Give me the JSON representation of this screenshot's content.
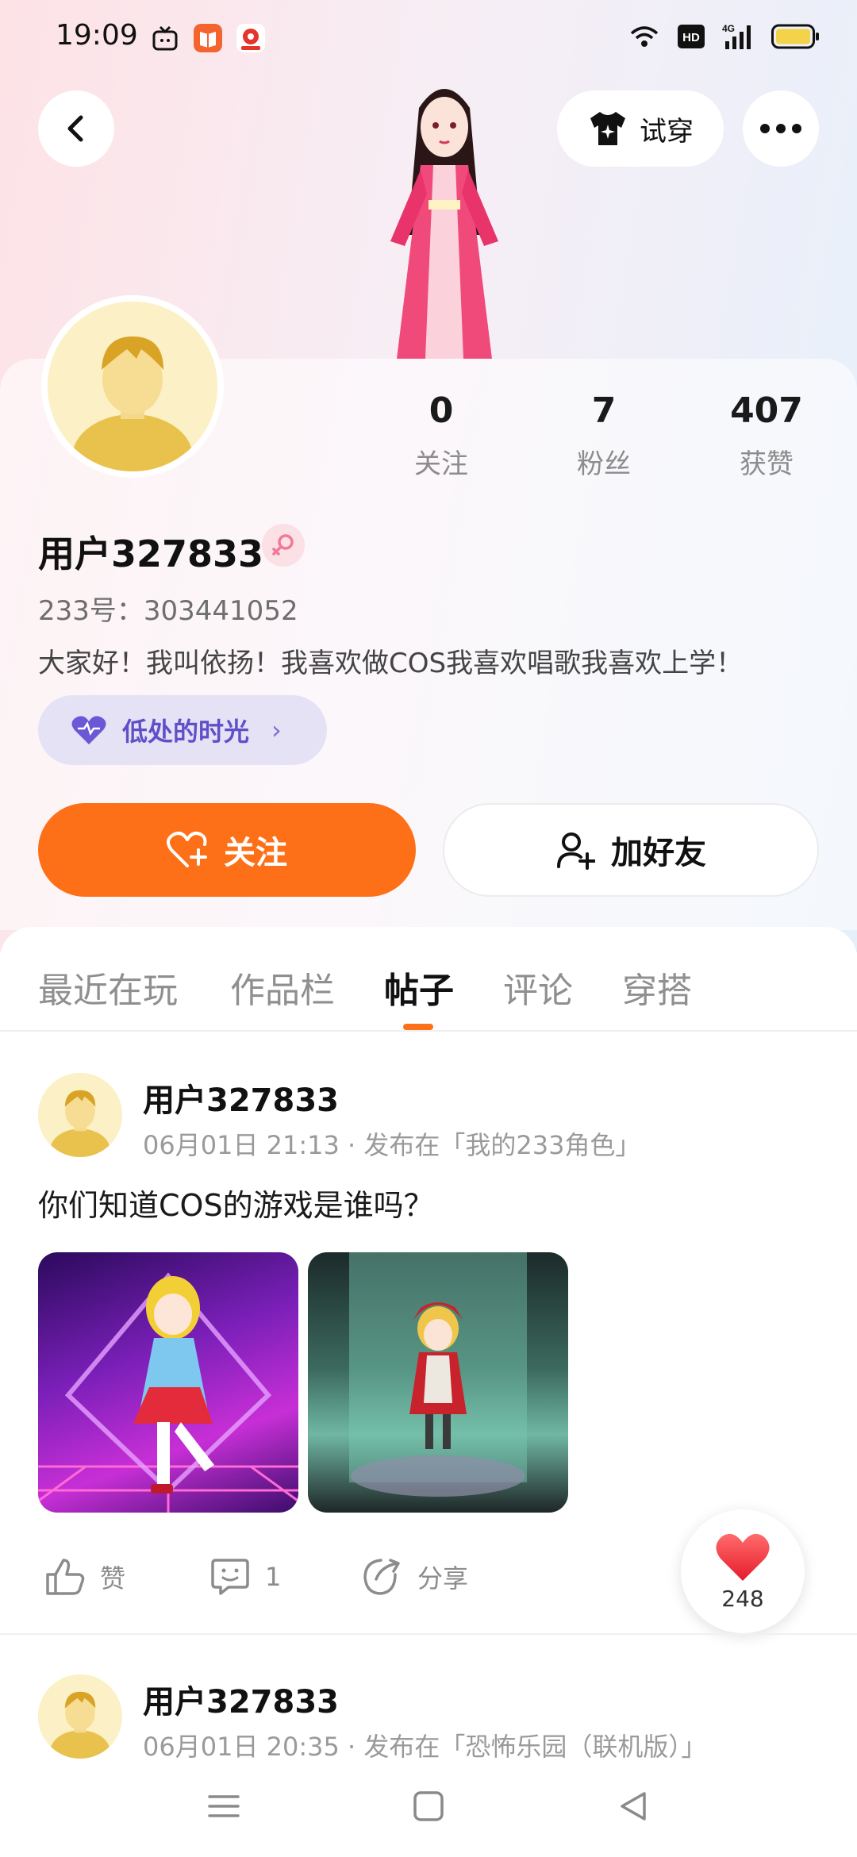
{
  "status_bar": {
    "time": "19:09",
    "icons": [
      "tv-app-icon",
      "book-app-icon",
      "location-app-icon",
      "wifi-icon",
      "hd-icon",
      "4g-signal-icon",
      "battery-icon"
    ]
  },
  "header": {
    "try_on_label": "试穿"
  },
  "stats": [
    {
      "value": "0",
      "label": "关注"
    },
    {
      "value": "7",
      "label": "粉丝"
    },
    {
      "value": "407",
      "label": "获赞"
    }
  ],
  "profile": {
    "username": "用户327833",
    "user_id": "233号：303441052",
    "bio": "大家好！我叫依扬！我喜欢做COS我喜欢唱歌我喜欢上学！",
    "mood": "低处的时光"
  },
  "buttons": {
    "follow": "关注",
    "add_friend": "加好友"
  },
  "tabs": [
    {
      "label": "最近在玩"
    },
    {
      "label": "作品栏"
    },
    {
      "label": "帖子"
    },
    {
      "label": "评论"
    },
    {
      "label": "穿搭"
    }
  ],
  "active_tab": "帖子",
  "posts": [
    {
      "author": "用户327833",
      "meta": "06月01日 21:13 · 发布在「我的233角色」",
      "text": "你们知道COS的游戏是谁吗？",
      "likes_label": "赞",
      "comments": "1",
      "share_label": "分享"
    },
    {
      "author": "用户327833",
      "meta": "06月01日 20:35 · 发布在「恐怖乐园（联机版）」"
    }
  ],
  "floating_like": {
    "count": "248"
  },
  "colors": {
    "accent": "#fe7018",
    "mood_chip_bg": "#e5e2f6",
    "mood_chip_text": "#5f4fc8",
    "heart_red": "#f23b3b"
  }
}
